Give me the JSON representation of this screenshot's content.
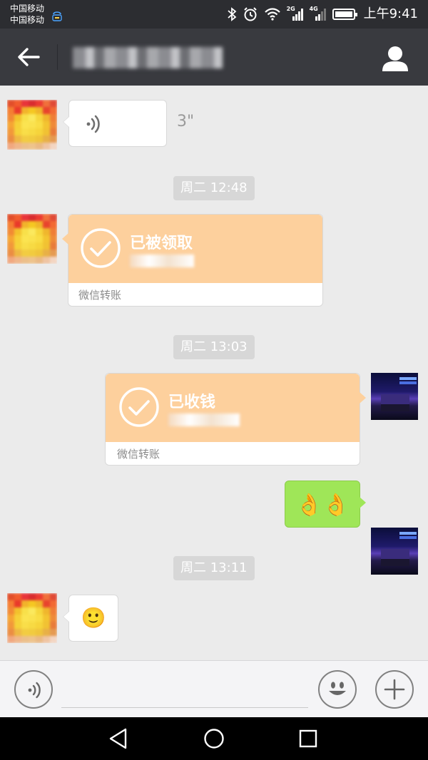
{
  "status_bar": {
    "carrier_1": "中国移动",
    "carrier_2": "中国移动",
    "net_2g": "2G",
    "net_4g": "4G",
    "time": "上午9:41",
    "icons": [
      "hd-call-icon",
      "bluetooth-icon",
      "alarm-icon",
      "wifi-icon",
      "signal-2g-icon",
      "signal-4g-icon",
      "battery-icon"
    ]
  },
  "header": {
    "title": "",
    "back_icon": "back-arrow-icon",
    "profile_icon": "profile-icon"
  },
  "messages": [
    {
      "kind": "voice",
      "side": "left",
      "duration": "3\""
    },
    {
      "kind": "timestamp",
      "text": "周二 12:48"
    },
    {
      "kind": "transfer",
      "side": "left",
      "status": "已被领取",
      "amount": "",
      "label": "微信转账"
    },
    {
      "kind": "timestamp",
      "text": "周二 13:03"
    },
    {
      "kind": "transfer",
      "side": "right",
      "status": "已收钱",
      "amount": "",
      "label": "微信转账"
    },
    {
      "kind": "emoji",
      "side": "right",
      "emoji": "👌👌"
    },
    {
      "kind": "timestamp",
      "text": "周二 13:11"
    },
    {
      "kind": "emoji",
      "side": "left",
      "emoji": "🙂"
    }
  ],
  "input_bar": {
    "voice_icon": "voice-input-icon",
    "placeholder": "",
    "emoji_icon": "emoji-icon",
    "plus_icon": "plus-icon"
  },
  "nav_bar": {
    "icons": [
      "nav-back-icon",
      "nav-home-icon",
      "nav-recent-icon"
    ]
  },
  "colors": {
    "status_bar": "#2c2d31",
    "title_bar": "#393a3f",
    "chat_bg": "#ebebeb",
    "transfer_orange": "#fdd09d",
    "green_bubble": "#9fe658",
    "timestamp_bg": "#d7d7d7"
  }
}
